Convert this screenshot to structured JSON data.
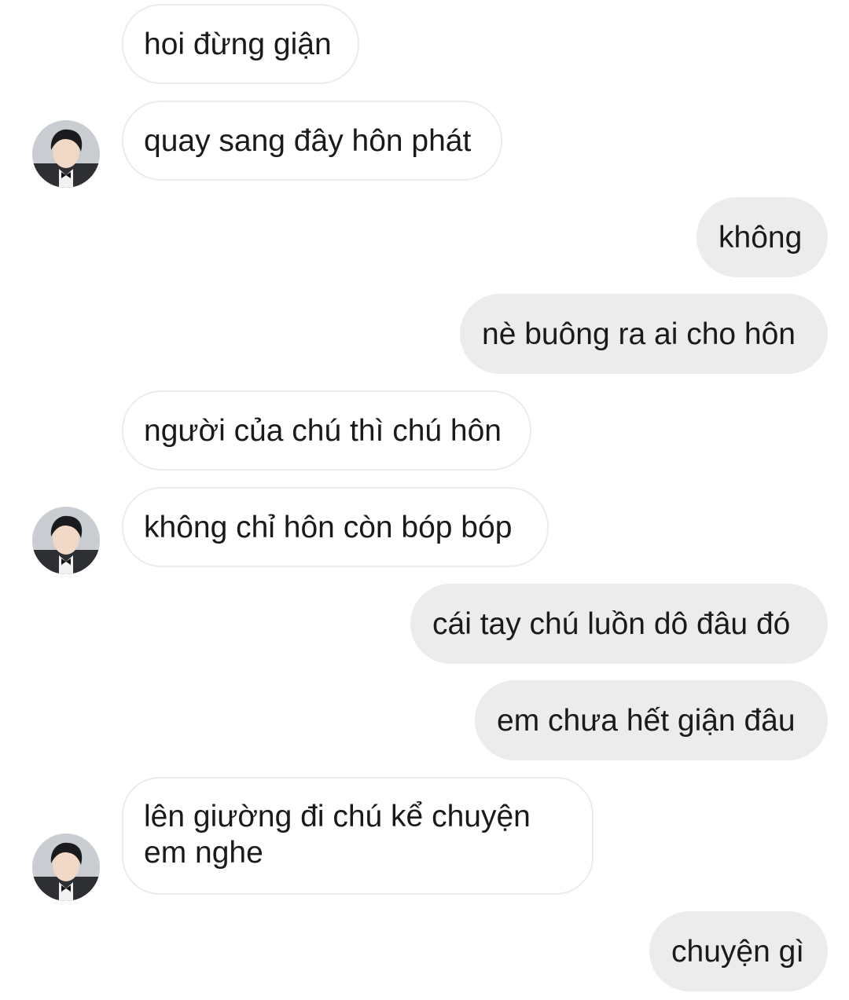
{
  "messages": [
    {
      "id": "m1",
      "side": "received",
      "text": "hoi đừng giận"
    },
    {
      "id": "m2",
      "side": "received",
      "text": "quay sang đây hôn phát",
      "avatar": true
    },
    {
      "id": "m3",
      "side": "sent",
      "text": "không"
    },
    {
      "id": "m4",
      "side": "sent",
      "text": "nè buông ra ai cho hôn"
    },
    {
      "id": "m5",
      "side": "received",
      "text": "người của chú thì chú hôn"
    },
    {
      "id": "m6",
      "side": "received",
      "text": "không chỉ hôn còn bóp bóp",
      "avatar": true
    },
    {
      "id": "m7",
      "side": "sent",
      "text": "cái tay chú luồn dô đâu đó"
    },
    {
      "id": "m8",
      "side": "sent",
      "text": "em chưa hết giận đâu"
    },
    {
      "id": "m9",
      "side": "received",
      "text": "lên giường đi chú kể chuyện em nghe",
      "avatar": true
    },
    {
      "id": "m10",
      "side": "sent",
      "text": "chuyện gì"
    }
  ],
  "colors": {
    "sent_bubble": "#ececec",
    "received_bubble": "#ffffff",
    "received_border": "#ececec",
    "text": "#1a1a1a"
  },
  "icons": {
    "avatar": "contact-avatar-photo"
  }
}
